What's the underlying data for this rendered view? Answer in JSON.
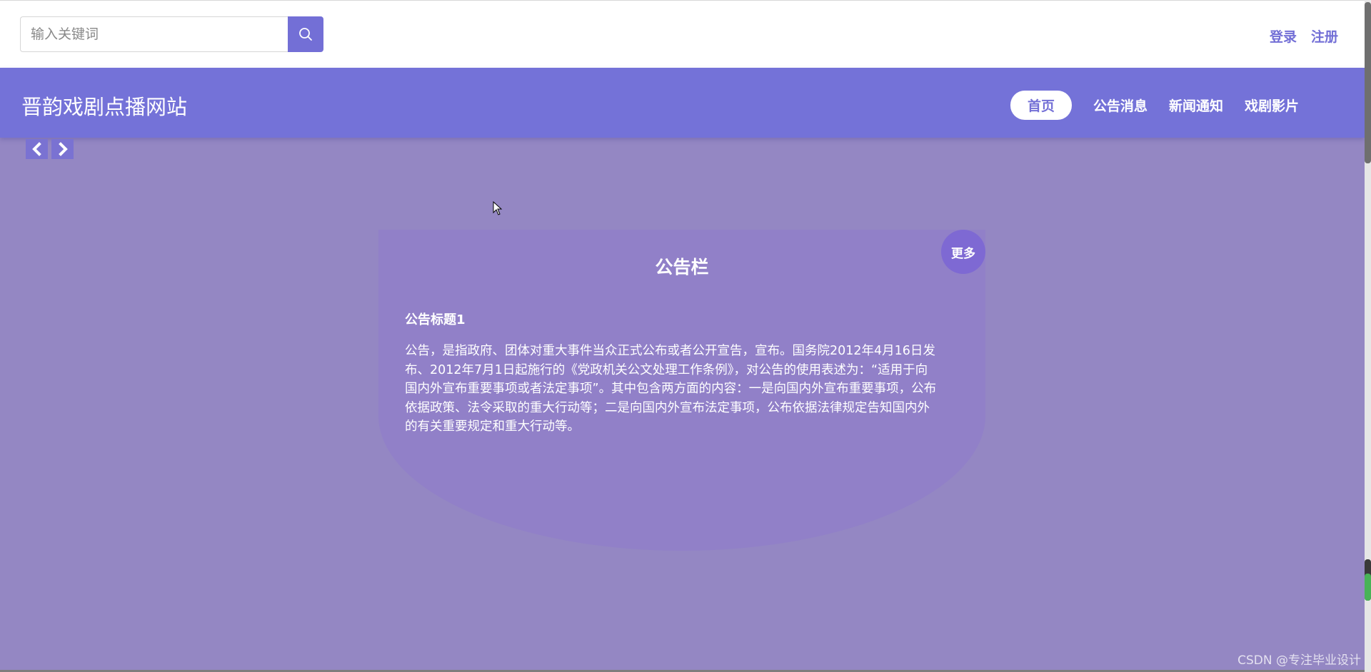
{
  "search": {
    "placeholder": "输入关键词",
    "icon": "search-icon"
  },
  "auth": {
    "login": "登录",
    "register": "注册"
  },
  "header": {
    "site_title": "晋韵戏剧点播网站",
    "nav": [
      {
        "label": "首页",
        "active": true
      },
      {
        "label": "公告消息",
        "active": false
      },
      {
        "label": "新闻通知",
        "active": false
      },
      {
        "label": "戏剧影片",
        "active": false
      }
    ]
  },
  "carousel": {
    "prev_icon": "chevron-left-icon",
    "next_icon": "chevron-right-icon"
  },
  "notice_board": {
    "title": "公告栏",
    "more_label": "更多",
    "item_title": "公告标题1",
    "item_body": "公告，是指政府、团体对重大事件当众正式公布或者公开宣告，宣布。国务院2012年4月16日发布、2012年7月1日起施行的《党政机关公文处理工作条例》，对公告的使用表述为：“适用于向国内外宣布重要事项或者法定事项”。其中包含两方面的内容：一是向国内外宣布重要事项，公布依据政策、法令采取的重大行动等；二是向国内外宣布法定事项，公布依据法律规定告知国内外的有关重要规定和重大行动等。"
  },
  "watermark": "CSDN @专注毕业设计",
  "colors": {
    "accent": "#736fd6",
    "nav_bg": "#7472d8",
    "page_bg": "#9487c3",
    "board_bg": "#9180c8"
  }
}
